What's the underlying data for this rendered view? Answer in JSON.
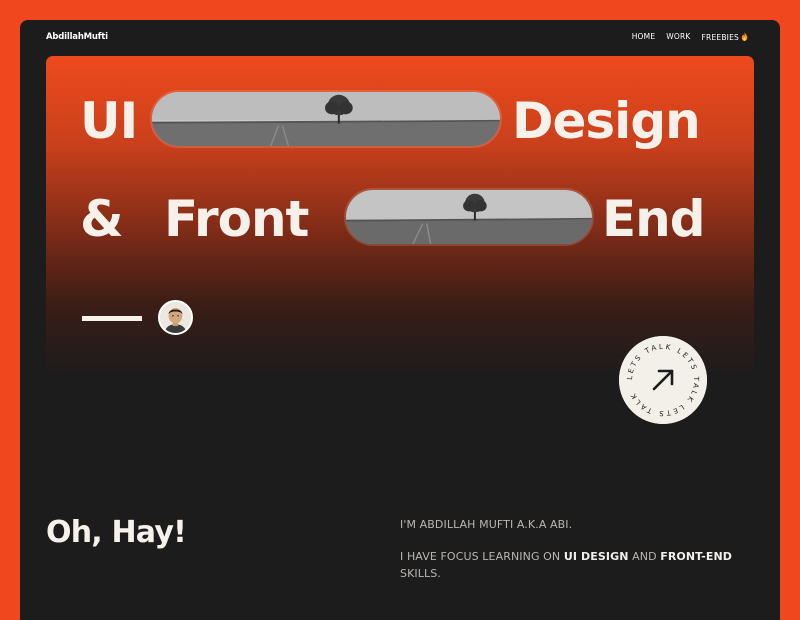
{
  "brand": "AbdillahMufti",
  "nav": {
    "items": [
      {
        "label": "HOME"
      },
      {
        "label": "WORK"
      },
      {
        "label": "FREEBIES",
        "icon": "fire-icon"
      }
    ]
  },
  "hero": {
    "line1": {
      "left": "UI",
      "right": "Design"
    },
    "line2": {
      "left": "&",
      "middle": "Front",
      "right": "End"
    },
    "images": [
      "tree-landscape-image",
      "tree-landscape-image"
    ],
    "avatar": "avatar-image"
  },
  "cta": {
    "circle_text": "LETS TALK  LETS TALK  LETS TALK  ",
    "icon": "arrow-up-right-icon"
  },
  "intro": {
    "heading": "Oh, Hay!",
    "line1": "I'M ABDILLAH MUFTI A.K.A ABI.",
    "line2_pre": "I HAVE FOCUS LEARNING ON ",
    "line2_strong1": "UI DESIGN",
    "line2_mid": " AND ",
    "line2_strong2": "FRONT-END",
    "line2_post": " SKILLS."
  },
  "colors": {
    "accent": "#f0471e",
    "background": "#1c1c1c",
    "text": "#f7f1ec"
  }
}
